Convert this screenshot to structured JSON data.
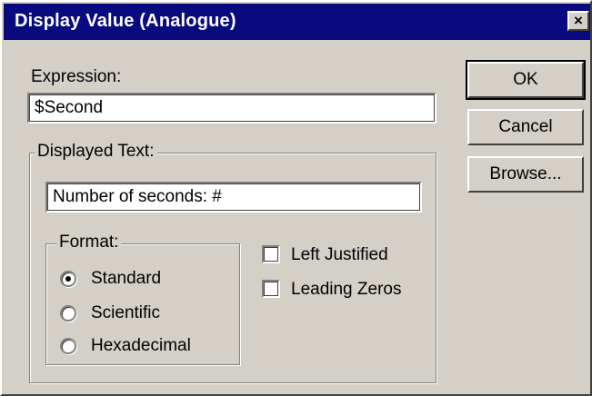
{
  "window": {
    "title": "Display Value (Analogue)",
    "close_glyph": "×"
  },
  "expression": {
    "label": "Expression:",
    "value": "$Second"
  },
  "displayed_text": {
    "group_label": "Displayed Text:",
    "value": "Number of seconds: #"
  },
  "format": {
    "group_label": "Format:",
    "options": [
      {
        "label": "Standard",
        "selected": true
      },
      {
        "label": "Scientific",
        "selected": false
      },
      {
        "label": "Hexadecimal",
        "selected": false
      }
    ]
  },
  "checkboxes": [
    {
      "label": "Left Justified",
      "checked": false
    },
    {
      "label": "Leading Zeros",
      "checked": false
    }
  ],
  "buttons": {
    "ok": "OK",
    "cancel": "Cancel",
    "browse": "Browse..."
  }
}
